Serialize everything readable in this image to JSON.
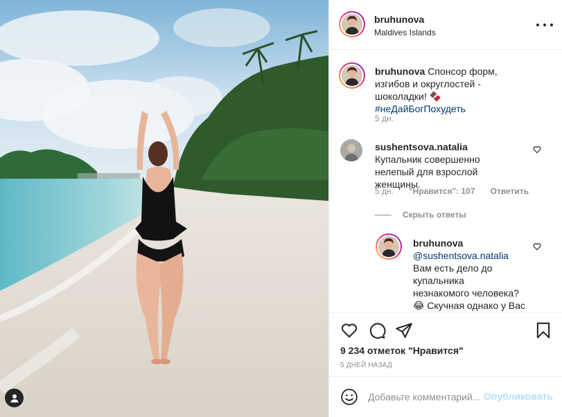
{
  "post": {
    "username": "bruhunova",
    "location": "Maldives Islands"
  },
  "caption": {
    "username": "bruhunova",
    "text": "Спонсор форм, изгибов и округлостей - шоколадки! 🍫",
    "hashtag": "#неДайБогПохудеть",
    "time": "5 дн."
  },
  "comment": {
    "username": "sushentsova.natalia",
    "text": "Купальник совершенно нелепый для взрослой женщины.",
    "time": "5 дн.",
    "likes": "\"Нравится\": 107",
    "reply_label": "Ответить",
    "hide_replies": "Скрыть ответы"
  },
  "reply": {
    "username": "bruhunova",
    "mention": "@sushentsova.natalia",
    "line1": "Вам есть дело до",
    "line2": "купальника",
    "line3": "незнакомого человека?",
    "line4": "😂 Скучная однако у Вас"
  },
  "actions": {
    "likes_count": "9 234 отметок \"Нравится\"",
    "posted_ago": "5 дней назад"
  },
  "add_comment": {
    "placeholder": "Добавьте комментарий...",
    "publish_label": "Опубликовать"
  },
  "colors": {
    "link": "#00376b",
    "publish_disabled": "#b2dffc",
    "muted": "#8e8e8e",
    "border": "#efefef"
  },
  "icons": [
    "more-icon",
    "heart-icon",
    "comment-icon",
    "share-icon",
    "bookmark-icon",
    "emoji-icon",
    "user-tag-icon"
  ]
}
